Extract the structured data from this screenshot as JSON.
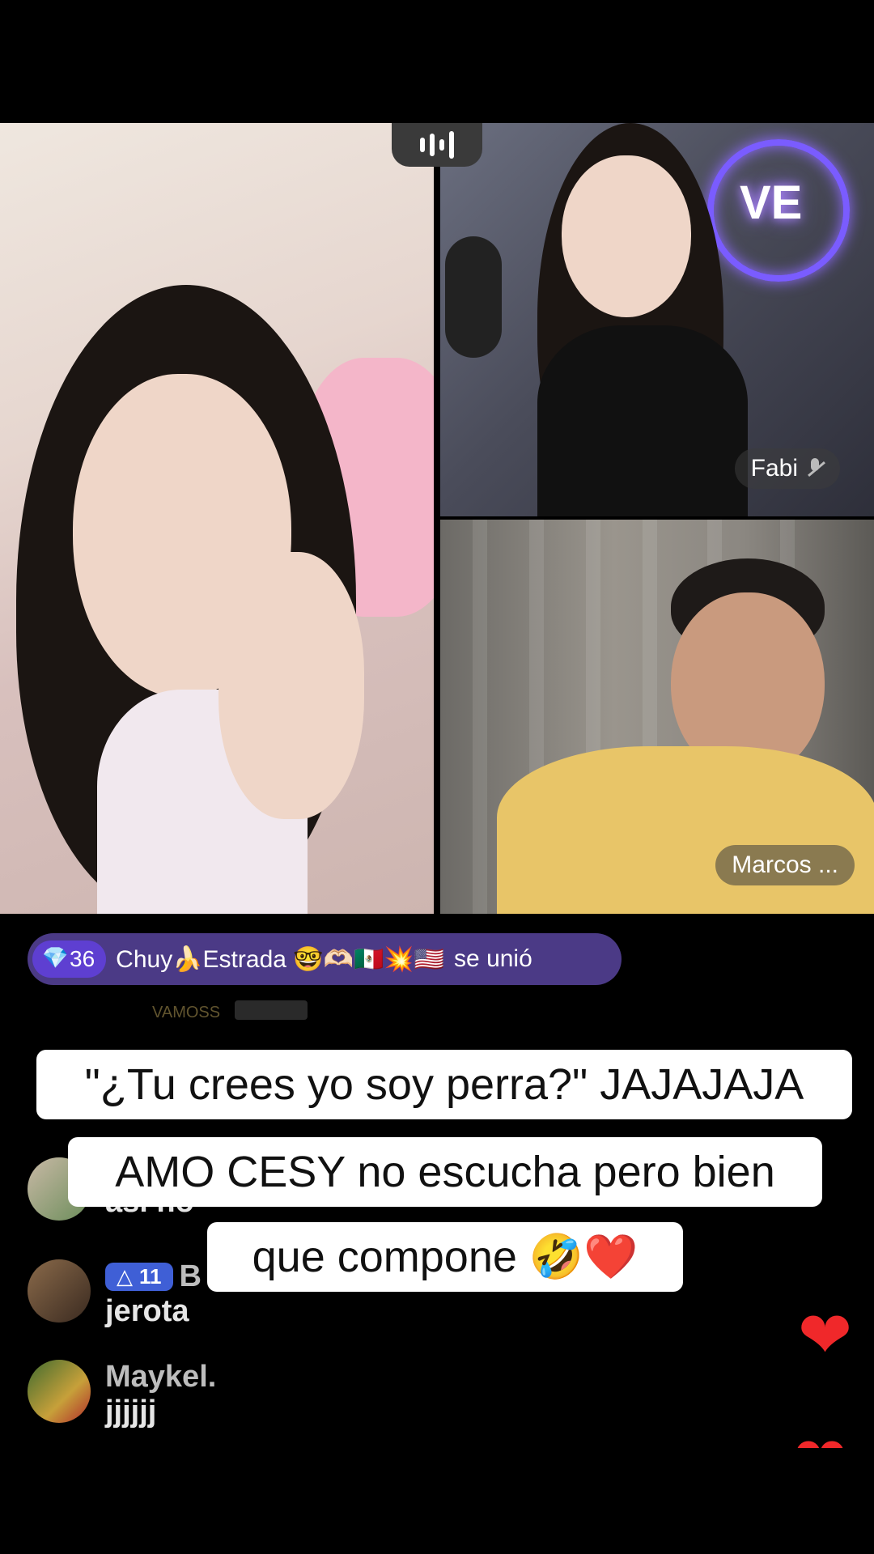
{
  "participants": [
    {
      "name": "",
      "muted": false
    },
    {
      "name": "Fabi",
      "muted": true
    },
    {
      "name": "Marcos ...",
      "muted": false
    }
  ],
  "live_sign_text": "VE",
  "join_banner": {
    "level": "36",
    "user": "Chuy🍌Estrada 🤓🫶🏻🇲🇽💥🇺🇸",
    "action": "se unió"
  },
  "faded_comment": {
    "text": "VAMOSS"
  },
  "comments": [
    {
      "name": "",
      "text": "así no"
    },
    {
      "badge_level": "11",
      "name": "B",
      "text": "jerota"
    },
    {
      "name": "Maykel.",
      "text": "jjjjjj"
    }
  ],
  "caption": {
    "line1": "\"¿Tu crees yo soy perra?\" JAJAJAJA",
    "line2": "AMO CESY no escucha pero bien",
    "line3": "que compone 🤣❤️"
  },
  "colors": {
    "join_banner_bg": "#4b3a86",
    "level_badge_bg": "#5e3fd1",
    "heart": "#f0282a"
  },
  "icons": [
    "audio-bars-icon",
    "mute-mic-icon",
    "diamond-icon",
    "heart-icon",
    "gift-icon"
  ]
}
